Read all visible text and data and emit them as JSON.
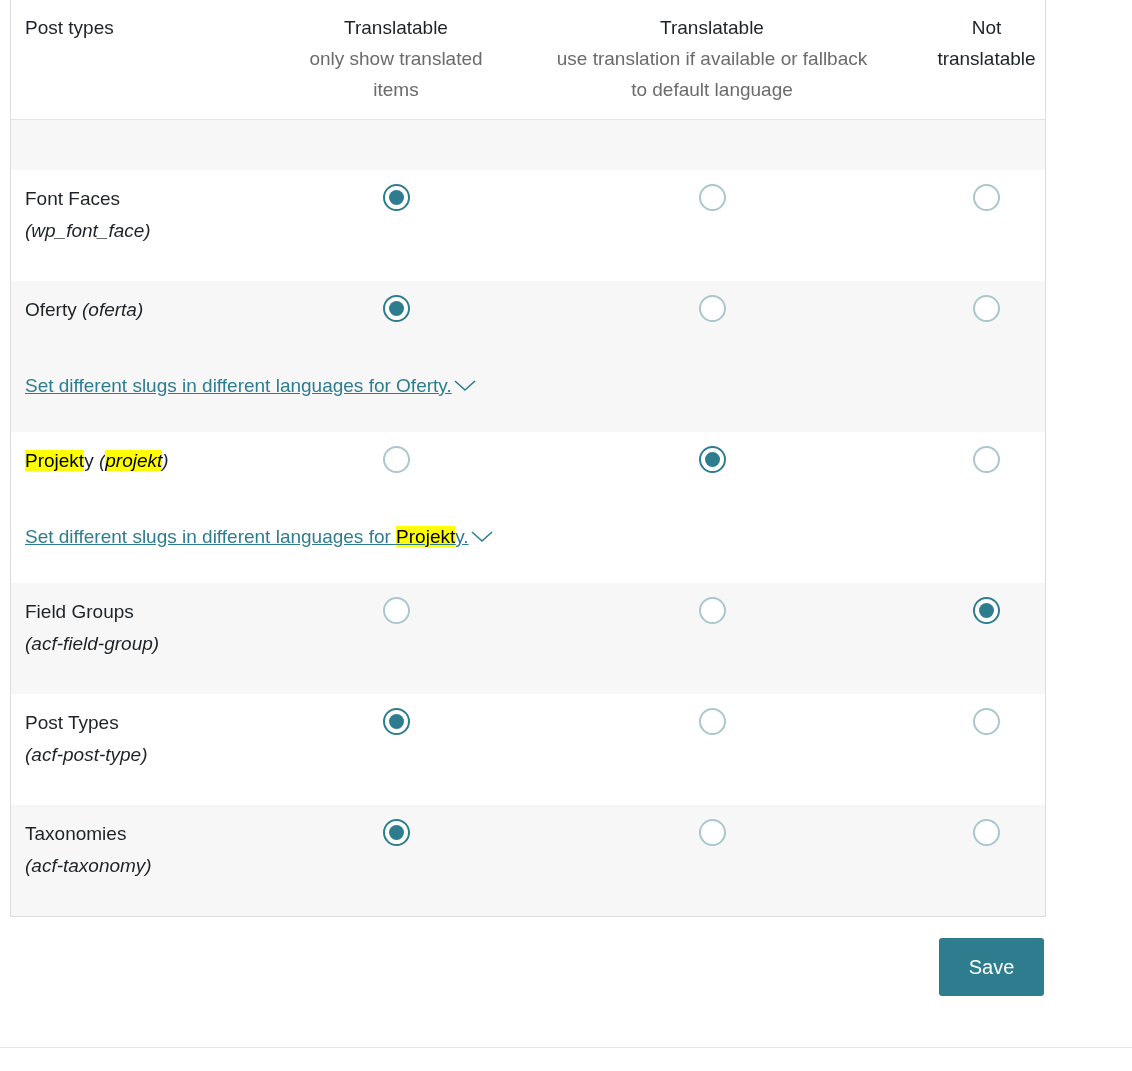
{
  "header": {
    "label_column": "Post types",
    "columns": [
      {
        "title": "Translatable",
        "subtitle": "only show translated items"
      },
      {
        "title": "Translatable",
        "subtitle": "use translation if available or fallback to default language"
      },
      {
        "title": "Not translatable"
      }
    ]
  },
  "rows": [
    {
      "kind": "stacked",
      "name": [
        {
          "text": "Font Faces",
          "highlighted": false
        }
      ],
      "slug": [
        {
          "text": "(wp_font_face)",
          "highlighted": false
        }
      ],
      "options": [
        {
          "selected": true
        },
        {
          "selected": false
        },
        {
          "selected": false
        }
      ]
    },
    {
      "kind": "inline",
      "name": [
        {
          "text": "Oferty",
          "highlighted": false
        }
      ],
      "slug": [
        {
          "text": "(oferta)",
          "highlighted": false
        }
      ],
      "options": [
        {
          "selected": true
        },
        {
          "selected": false
        },
        {
          "selected": false
        }
      ],
      "link": [
        {
          "text": "Set different slugs in different languages for Oferty.",
          "highlighted": false
        }
      ]
    },
    {
      "kind": "inline",
      "name": [
        {
          "text": "Projekt",
          "highlighted": true
        },
        {
          "text": "y",
          "highlighted": false
        }
      ],
      "slug": [
        {
          "text": "(",
          "highlighted": false
        },
        {
          "text": "projekt",
          "highlighted": true
        },
        {
          "text": ")",
          "highlighted": false
        }
      ],
      "options": [
        {
          "selected": false
        },
        {
          "selected": true
        },
        {
          "selected": false
        }
      ],
      "link": [
        {
          "text": "Set different slugs in different languages for ",
          "highlighted": false
        },
        {
          "text": "Projekt",
          "highlighted": true
        },
        {
          "text": "y.",
          "highlighted": false
        }
      ]
    },
    {
      "kind": "stacked",
      "name": [
        {
          "text": "Field Groups",
          "highlighted": false
        }
      ],
      "slug": [
        {
          "text": "(acf-field-group)",
          "highlighted": false
        }
      ],
      "options": [
        {
          "selected": false
        },
        {
          "selected": false
        },
        {
          "selected": true
        }
      ]
    },
    {
      "kind": "stacked",
      "name": [
        {
          "text": "Post Types",
          "highlighted": false
        }
      ],
      "slug": [
        {
          "text": "(acf-post-type)",
          "highlighted": false
        }
      ],
      "options": [
        {
          "selected": true
        },
        {
          "selected": false
        },
        {
          "selected": false
        }
      ]
    },
    {
      "kind": "stacked",
      "name": [
        {
          "text": "Taxonomies",
          "highlighted": false
        }
      ],
      "slug": [
        {
          "text": "(acf-taxonomy)",
          "highlighted": false
        }
      ],
      "options": [
        {
          "selected": true
        },
        {
          "selected": false
        },
        {
          "selected": false
        }
      ]
    }
  ],
  "save_button": "Save"
}
